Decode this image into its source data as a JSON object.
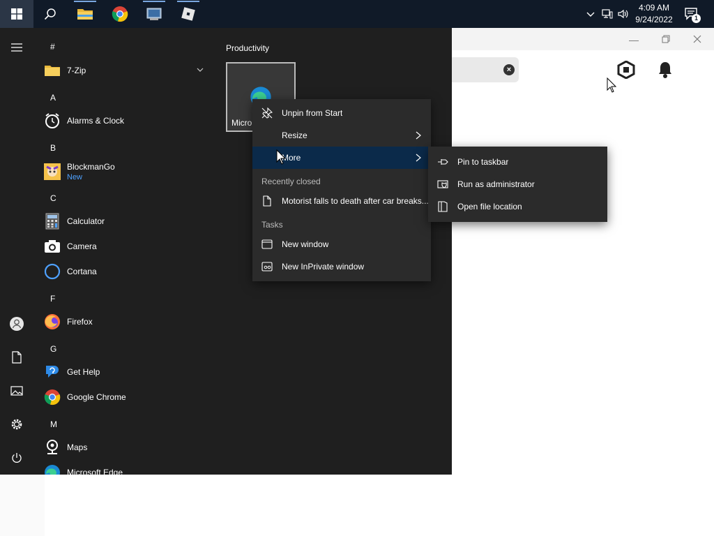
{
  "taskbar": {
    "pinned": [
      {
        "name": "search-icon"
      },
      {
        "name": "file-explorer-icon"
      },
      {
        "name": "chrome-icon"
      },
      {
        "name": "control-panel-icon"
      },
      {
        "name": "roblox-icon"
      }
    ],
    "clock_time": "4:09 AM",
    "clock_date": "9/24/2022",
    "notification_count": "1"
  },
  "start_menu": {
    "letters": {
      "hash": "#",
      "a": "A",
      "b": "B",
      "c": "C",
      "f": "F",
      "g": "G",
      "m": "M"
    },
    "apps": {
      "zip": "7-Zip",
      "alarms": "Alarms & Clock",
      "blockman": "BlockmanGo",
      "blockman_badge": "New",
      "calculator": "Calculator",
      "camera": "Camera",
      "cortana": "Cortana",
      "firefox": "Firefox",
      "gethelp": "Get Help",
      "chrome": "Google Chrome",
      "maps": "Maps",
      "edge": "Microsoft Edge"
    },
    "tiles_group": "Productivity",
    "tile_label": "Micro"
  },
  "context_menu": {
    "unpin": "Unpin from Start",
    "resize": "Resize",
    "more": "More",
    "recently_closed_header": "Recently closed",
    "recent_item": "Motorist falls to death after car breaks...",
    "tasks_header": "Tasks",
    "new_window": "New window",
    "new_private": "New InPrivate window"
  },
  "submenu": {
    "pin_taskbar": "Pin to taskbar",
    "run_admin": "Run as administrator",
    "open_location": "Open file location"
  },
  "colors": {
    "taskbar": "#101a28",
    "start_bg": "#1f1f1f",
    "menu_bg": "#2b2b2b",
    "highlight": "#0b2a4a",
    "accent": "#4ea1ff"
  }
}
